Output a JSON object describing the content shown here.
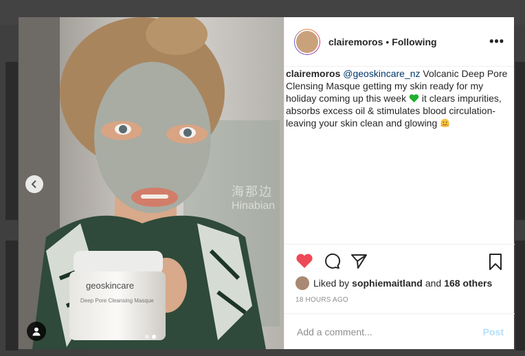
{
  "post": {
    "username": "clairemoros",
    "separator": "•",
    "follow_status": "Following",
    "more_label": "•••",
    "caption": {
      "username": "clairemoros",
      "mention": "@geoskincare_nz",
      "text_1": " Volcanic Deep Pore Clensing Masque getting my skin ready for my holiday coming up this week ",
      "text_2": " it clears impurities, absorbs excess oil & stimulates blood circulation- leaving your skin clean and glowing "
    },
    "likes": {
      "prefix": "Liked by",
      "user": "sophiemaitland",
      "middle": "and",
      "count": "168 others"
    },
    "timestamp": "18 HOURS AGO",
    "comment_placeholder": "Add a comment...",
    "post_label": "Post"
  },
  "photo": {
    "product_brand": "geoskincare",
    "product_line": "Deep Pore Cleansing Masque",
    "watermark_cn": "海那边",
    "watermark_en": "Hinabian"
  },
  "carousel": {
    "slides": 2,
    "active_index": 1
  },
  "colors": {
    "like_red": "#ed4956",
    "mention_blue": "#00376b",
    "post_disabled": "#b2dffc"
  }
}
